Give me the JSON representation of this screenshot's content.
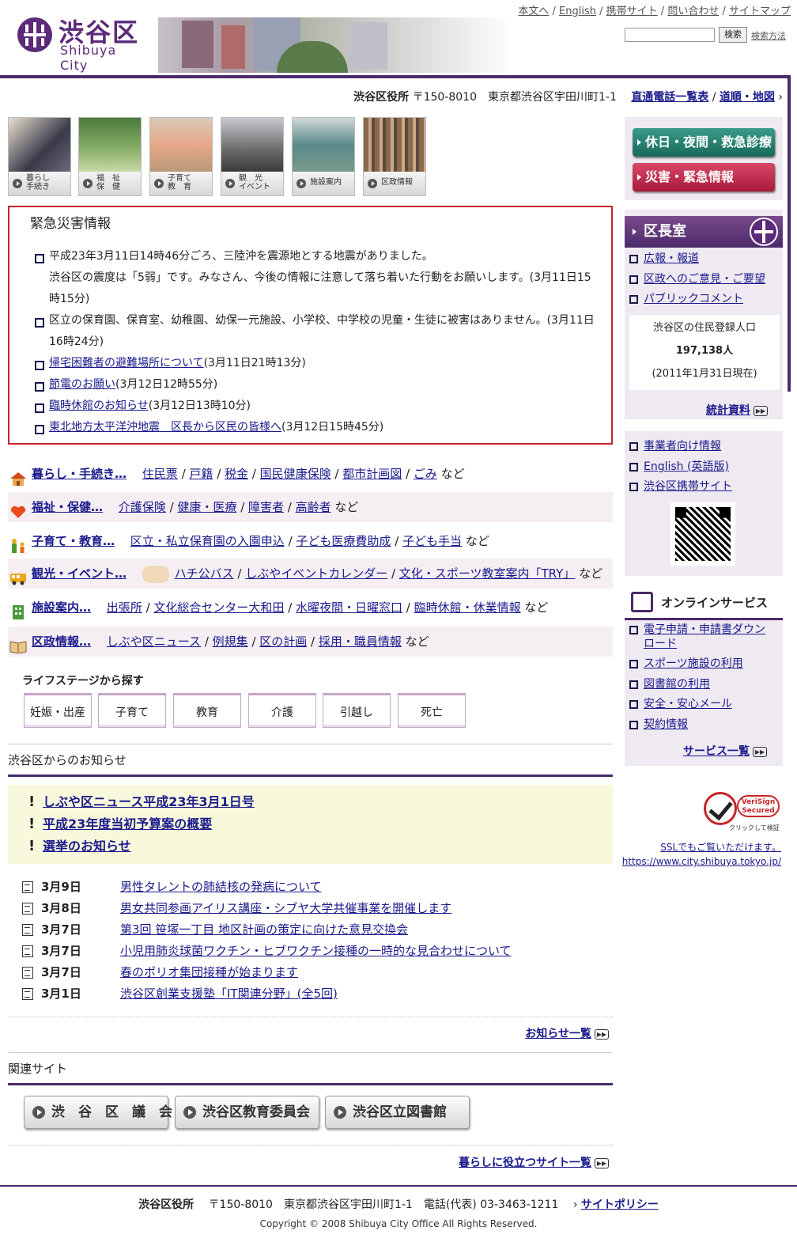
{
  "header": {
    "logo_kanji": "渋谷区",
    "logo_roman": "Shibuya City",
    "util_links": [
      "本文へ",
      "English",
      "携帯サイト",
      "問い合わせ",
      "サイトマップ"
    ],
    "search_button": "検索",
    "search_help": "検索方法"
  },
  "address_bar": {
    "office": "渋谷区役所",
    "address": "〒150-8010　東京都渋谷区宇田川町1-1",
    "link_phone": "直通電話一覧表",
    "link_map": "道順・地図"
  },
  "categories": [
    {
      "label": "暮らし\n手続き"
    },
    {
      "label": "福　祉\n保　健"
    },
    {
      "label": "子育て\n教　育"
    },
    {
      "label": "観　光\nイベント"
    },
    {
      "label": "施設案内"
    },
    {
      "label": "区政情報"
    }
  ],
  "emergency": {
    "title": "緊急災害情報",
    "items": [
      {
        "text": "平成23年3月11日14時46分ごろ、三陸沖を震源地とする地震がありました。",
        "link": ""
      },
      {
        "text": "渋谷区の震度は「5弱」です。みなさん、今後の情報に注意して落ち着いた行動をお願いします。(3月11日15時15分)",
        "link": ""
      },
      {
        "text": "区立の保育園、保育室、幼稚園、幼保一元施設、小学校、中学校の児童・生徒に被害はありません。(3月11日16時24分)",
        "link": ""
      },
      {
        "text": "(3月11日21時13分)",
        "link": "帰宅困難者の避難場所について"
      },
      {
        "text": "(3月12日12時55分)",
        "link": "節電のお願い"
      },
      {
        "text": "(3月12日13時10分)",
        "link": "臨時休館のお知らせ"
      },
      {
        "text": "(3月12日15時45分)",
        "link": "東北地方太平洋沖地震　区長から区民の皆様へ"
      }
    ]
  },
  "rows": [
    {
      "title": "暮らし・手続き…",
      "links": [
        "住民票",
        "戸籍",
        "税金",
        "国民健康保険",
        "都市計画図",
        "ごみ"
      ],
      "suffix": "など"
    },
    {
      "title": "福祉・保健…",
      "links": [
        "介護保険",
        "健康・医療",
        "障害者",
        "高齢者"
      ],
      "suffix": "など"
    },
    {
      "title": "子育て・教育…",
      "links": [
        "区立・私立保育園の入園申込",
        "子ども医療費助成",
        "子ども手当"
      ],
      "suffix": "など"
    },
    {
      "title": "観光・イベント…",
      "links": [
        "ハチ公バス",
        "しぶやイベントカレンダー",
        "文化・スポーツ教室案内「TRY」"
      ],
      "suffix": "など"
    },
    {
      "title": "施設案内…",
      "links": [
        "出張所",
        "文化総合センター大和田",
        "水曜夜間・日曜窓口",
        "臨時休館・休業情報"
      ],
      "suffix": "など"
    },
    {
      "title": "区政情報…",
      "links": [
        "しぶや区ニュース",
        "例規集",
        "区の計画",
        "採用・職員情報"
      ],
      "suffix": "など"
    }
  ],
  "lifestage": {
    "title": "ライフステージから探す",
    "buttons": [
      "妊娠・出産",
      "子育て",
      "教育",
      "介護",
      "引越し",
      "死亡"
    ]
  },
  "notices": {
    "title": "渋谷区からのお知らせ",
    "highlights": [
      "しぶや区ニュース平成23年3月1日号",
      "平成23年度当初予算案の概要",
      "選挙のお知らせ"
    ],
    "news": [
      {
        "date": "3月9日",
        "title": "男性タレントの肺結核の発病について"
      },
      {
        "date": "3月8日",
        "title": "男女共同参画アイリス講座・シブヤ大学共催事業を開催します"
      },
      {
        "date": "3月7日",
        "title": "第3回 笹塚一丁目 地区計画の策定に向けた意見交換会"
      },
      {
        "date": "3月7日",
        "title": "小児用肺炎球菌ワクチン・ヒブワクチン接種の一時的な見合わせについて"
      },
      {
        "date": "3月7日",
        "title": "春のポリオ集団接種が始まります"
      },
      {
        "date": "3月1日",
        "title": "渋谷区創業支援塾「IT関連分野」(全5回)"
      }
    ],
    "more": "お知らせ一覧"
  },
  "related": {
    "title": "関連サイト",
    "buttons": [
      "渋　谷　区　議　会",
      "渋谷区教育委員会",
      "渋谷区立図書館"
    ],
    "more": "暮らしに役立つサイト一覧"
  },
  "sidebar": {
    "btn_holiday": "休日・夜間・救急診療",
    "btn_disaster": "災害・緊急情報",
    "mayor_title": "区長室",
    "mayor_links": [
      "広報・報道",
      "区政へのご意見・ご要望",
      "パブリックコメント"
    ],
    "pop_title": "渋谷区の住民登録人口",
    "pop_value": "197,138人",
    "pop_date": "(2011年1月31日現在)",
    "stats_link": "統計資料",
    "biz_links": [
      "事業者向け情報",
      "English (英語版)",
      "渋谷区携帯サイト"
    ],
    "online_title": "オンラインサービス",
    "online_links": [
      "電子申請・申請書ダウンロード",
      "スポーツ施設の利用",
      "図書館の利用",
      "安全・安心メール",
      "契約情報"
    ],
    "services_more": "サービス一覧",
    "verisign_text": "VeriSign Secured",
    "verisign_caption": "クリックして検証",
    "ssl_text": "SSLでもご覧いただけます。",
    "ssl_url": "https://www.city.shibuya.tokyo.jp/"
  },
  "footer": {
    "office": "渋谷区役所",
    "address": "〒150-8010　東京都渋谷区宇田川町1-1　電話(代表) 03-3463-1211",
    "policy": "サイトポリシー",
    "copyright": "Copyright © 2008 Shibuya City Office All Rights Reserved."
  },
  "colors": {
    "brand": "#5c2a7a",
    "emergency": "#c8242a",
    "holiday_btn": "#2a7a6a",
    "disaster_btn": "#b82a4a",
    "link": "#1a1a8c"
  }
}
